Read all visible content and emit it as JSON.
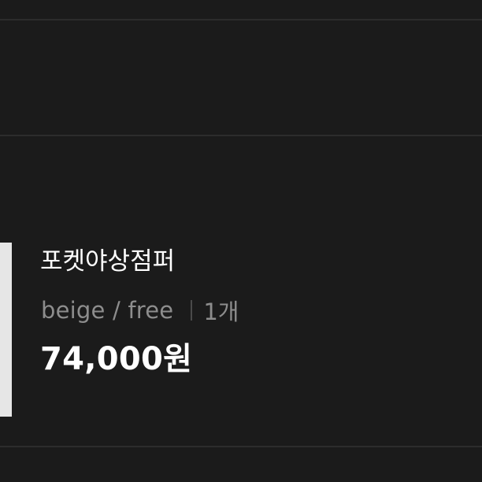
{
  "colors": {
    "background": "#1b1b1b",
    "divider": "#2c2c2c",
    "primary_text": "#ffffff",
    "secondary_text": "#8d8d8d",
    "thumbnail": "#e6e6e6"
  },
  "product": {
    "name": "포켓야상점퍼",
    "option": "beige / free",
    "quantity": "1개",
    "price": "74,000원"
  }
}
